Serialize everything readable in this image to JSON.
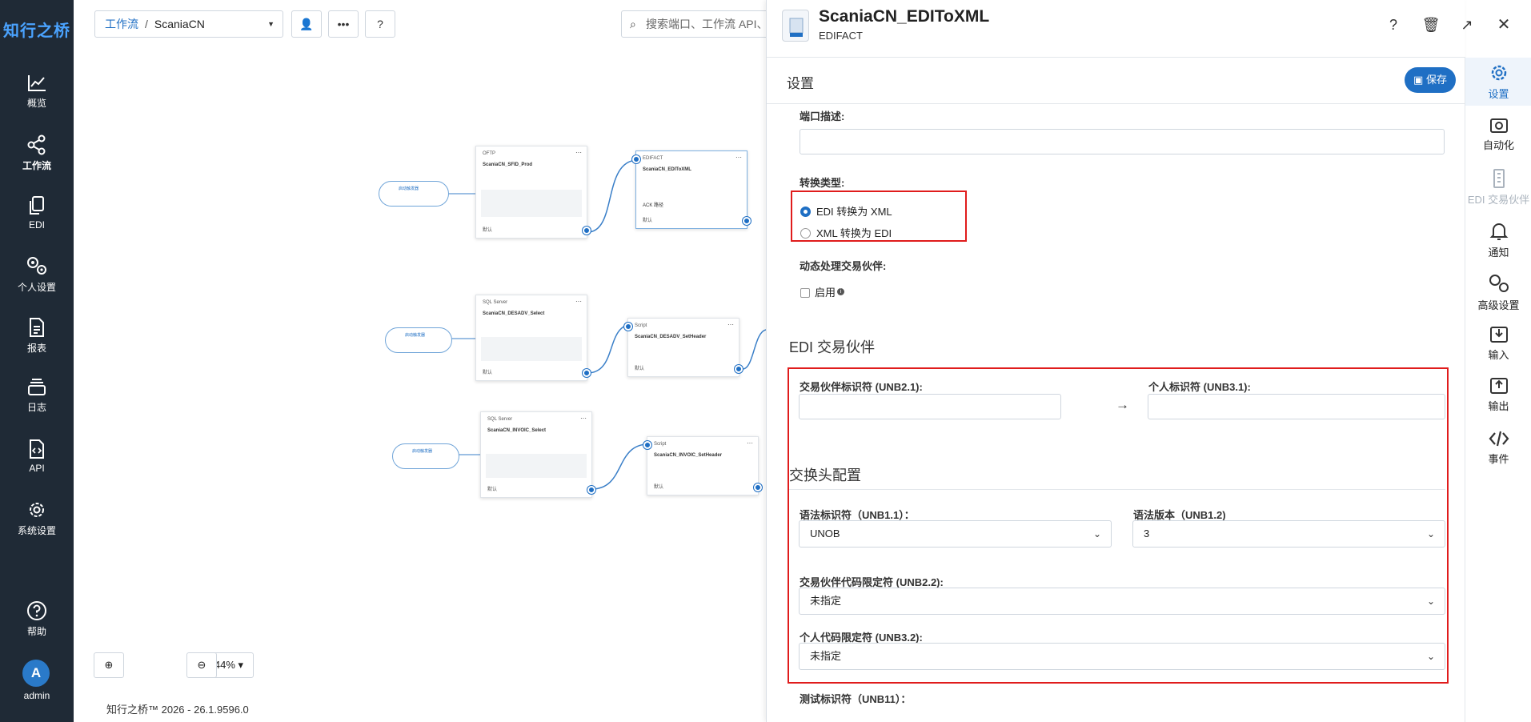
{
  "brand": "知行之桥",
  "sidebar": {
    "items": [
      {
        "label": "概览"
      },
      {
        "label": "工作流"
      },
      {
        "label": "EDI"
      },
      {
        "label": "个人设置"
      },
      {
        "label": "报表"
      },
      {
        "label": "日志"
      },
      {
        "label": "API"
      },
      {
        "label": "系统设置"
      },
      {
        "label": "帮助"
      }
    ],
    "user": {
      "initial": "A",
      "name": "admin"
    }
  },
  "toolbar": {
    "breadcrumb_link": "工作流",
    "breadcrumb_sep": "/",
    "breadcrumb_current": "ScaniaCN",
    "search_placeholder": "搜索端口、工作流 API、…"
  },
  "canvas": {
    "zoom_level": "44%",
    "nodes": [
      {
        "type": "OFTP",
        "name": "ScaniaCN_SFID_Prod",
        "foot": "默认"
      },
      {
        "type": "EDIFACT",
        "name": "ScaniaCN_EDIToXML",
        "foot": "默认",
        "extra": "ACK 路径"
      },
      {
        "type": "SQL Server",
        "name": "ScaniaCN_DESADV_Select",
        "foot": "默认"
      },
      {
        "type": "Script",
        "name": "ScaniaCN_DESADV_SetHeader",
        "foot": "默认"
      },
      {
        "type": "SQL Server",
        "name": "ScaniaCN_INVOIC_Select",
        "foot": "默认"
      },
      {
        "type": "Script",
        "name": "ScaniaCN_INVOIC_SetHeader",
        "foot": "默认"
      }
    ],
    "triggers": [
      {
        "label": "启动触发器"
      },
      {
        "label": "启动触发器"
      },
      {
        "label": "启动触发器"
      }
    ]
  },
  "footer": "知行之桥™ 2026 - 26.1.9596.0",
  "panel": {
    "title": "ScaniaCN_EDIToXML",
    "subtitle": "EDIFACT",
    "settings_title": "设置",
    "save_label": "保存",
    "port_desc_label": "端口描述:",
    "conversion_type_label": "转换类型:",
    "radio_options": [
      {
        "label": "EDI 转换为 XML",
        "selected": true
      },
      {
        "label": "XML 转换为 EDI",
        "selected": false
      }
    ],
    "dynamic_partner_label": "动态处理交易伙伴:",
    "enable_label": "启用",
    "partner_section_title": "EDI 交易伙伴",
    "partner_id_label": "交易伙伴标识符 (UNB2.1):",
    "personal_id_label": "个人标识符 (UNB3.1):",
    "exchange_header_title": "交换头配置",
    "syntax_id_label": "语法标识符（UNB1.1）：",
    "syntax_id_value": "UNOB",
    "syntax_version_label": "语法版本（UNB1.2)",
    "syntax_version_value": "3",
    "partner_qualifier_label": "交易伙伴代码限定符 (UNB2.2):",
    "partner_qualifier_value": "未指定",
    "personal_qualifier_label": "个人代码限定符 (UNB3.2):",
    "personal_qualifier_value": "未指定",
    "test_indicator_label": "测试标识符（UNB11）："
  },
  "rail": {
    "items": [
      {
        "label": "设置"
      },
      {
        "label": "自动化"
      },
      {
        "label": "EDI 交易伙伴"
      },
      {
        "label": "通知"
      },
      {
        "label": "高级设置"
      },
      {
        "label": "输入"
      },
      {
        "label": "输出"
      },
      {
        "label": "事件"
      }
    ]
  },
  "colors": {
    "accent": "#1f6fc4",
    "sidebar_bg": "#1f2a36",
    "highlight_box": "#e01c1c"
  }
}
